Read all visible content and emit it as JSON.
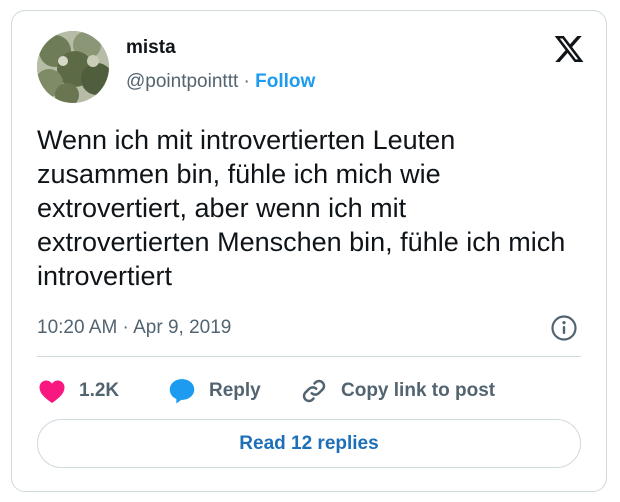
{
  "tweet": {
    "author_name": "mista",
    "handle": "@pointpointtt",
    "separator": " · ",
    "follow_label": "Follow",
    "text": "Wenn ich mit introvertierten Leuten zusammen bin, fühle ich mich wie extrovertiert, aber wenn ich mit extrovertierten Menschen bin, fühle ich mich introvertiert",
    "time": "10:20 AM",
    "date": "Apr 9, 2019",
    "meta_separator": " · "
  },
  "actions": {
    "like_count": "1.2K",
    "reply_label": "Reply",
    "copy_label": "Copy link to post"
  },
  "footer": {
    "read_replies_label": "Read 12 replies"
  },
  "icons": {
    "logo": "x-logo-icon",
    "like": "heart-icon",
    "reply": "speech-bubble-icon",
    "copy": "link-icon",
    "info": "info-icon"
  },
  "colors": {
    "accent": "#1d9bf0",
    "like": "#f91880",
    "text": "#0f1419",
    "muted": "#536471",
    "border": "#cfd9de"
  }
}
